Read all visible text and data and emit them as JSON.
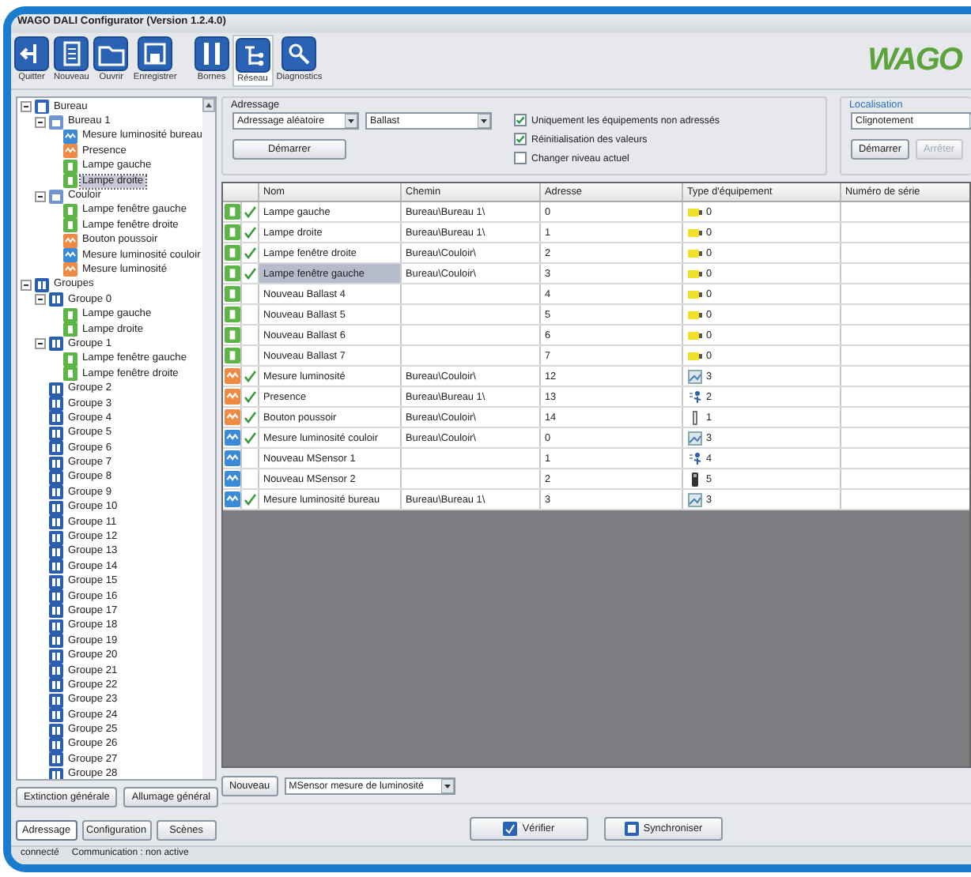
{
  "window": {
    "title": "WAGO DALI Configurator (Version 1.2.4.0)"
  },
  "toolbar": [
    {
      "label": "Quitter",
      "kind": "exit",
      "selected": false
    },
    {
      "label": "Nouveau",
      "kind": "new",
      "selected": false
    },
    {
      "label": "Ouvrir",
      "kind": "open",
      "selected": false
    },
    {
      "label": "Enregistrer",
      "kind": "save",
      "selected": false
    },
    {
      "label": "Bornes",
      "kind": "terminals",
      "selected": false
    },
    {
      "label": "Réseau",
      "kind": "network",
      "selected": true
    },
    {
      "label": "Diagnostics",
      "kind": "diagnostics",
      "selected": false
    }
  ],
  "logo": "WAGO",
  "tree": [
    {
      "label": "Bureau",
      "kind": "building",
      "selected": false,
      "expanded": true,
      "children": [
        {
          "label": "Bureau 1",
          "kind": "room",
          "selected": false,
          "expanded": true,
          "children": [
            {
              "label": "Mesure luminosité bureau",
              "kind": "sensor",
              "selected": false
            },
            {
              "label": "Presence",
              "kind": "input",
              "selected": false
            },
            {
              "label": "Lampe gauche",
              "kind": "lamp",
              "selected": false
            },
            {
              "label": "Lampe droite",
              "kind": "lamp",
              "selected": true
            }
          ]
        },
        {
          "label": "Couloir",
          "kind": "room",
          "selected": false,
          "expanded": true,
          "children": [
            {
              "label": "Lampe fenêtre gauche",
              "kind": "lamp",
              "selected": false
            },
            {
              "label": "Lampe fenêtre droite",
              "kind": "lamp",
              "selected": false
            },
            {
              "label": "Bouton poussoir",
              "kind": "input",
              "selected": false
            },
            {
              "label": "Mesure luminosité couloir",
              "kind": "sensor",
              "selected": false
            },
            {
              "label": "Mesure luminosité",
              "kind": "input",
              "selected": false
            }
          ]
        }
      ]
    },
    {
      "label": "Groupes",
      "kind": "group",
      "selected": false,
      "expanded": true,
      "children": [
        {
          "label": "Groupe 0",
          "kind": "group",
          "selected": false,
          "expanded": true,
          "children": [
            {
              "label": "Lampe gauche",
              "kind": "lamp",
              "selected": false
            },
            {
              "label": "Lampe droite",
              "kind": "lamp",
              "selected": false
            }
          ]
        },
        {
          "label": "Groupe 1",
          "kind": "group",
          "selected": false,
          "expanded": true,
          "children": [
            {
              "label": "Lampe fenêtre gauche",
              "kind": "lamp",
              "selected": false
            },
            {
              "label": "Lampe fenêtre droite",
              "kind": "lamp",
              "selected": false
            }
          ]
        },
        {
          "label": "Groupe 2",
          "kind": "group",
          "selected": false
        },
        {
          "label": "Groupe 3",
          "kind": "group",
          "selected": false
        },
        {
          "label": "Groupe 4",
          "kind": "group",
          "selected": false
        },
        {
          "label": "Groupe 5",
          "kind": "group",
          "selected": false
        },
        {
          "label": "Groupe 6",
          "kind": "group",
          "selected": false
        },
        {
          "label": "Groupe 7",
          "kind": "group",
          "selected": false
        },
        {
          "label": "Groupe 8",
          "kind": "group",
          "selected": false
        },
        {
          "label": "Groupe 9",
          "kind": "group",
          "selected": false
        },
        {
          "label": "Groupe 10",
          "kind": "group",
          "selected": false
        },
        {
          "label": "Groupe 11",
          "kind": "group",
          "selected": false
        },
        {
          "label": "Groupe 12",
          "kind": "group",
          "selected": false
        },
        {
          "label": "Groupe 13",
          "kind": "group",
          "selected": false
        },
        {
          "label": "Groupe 14",
          "kind": "group",
          "selected": false
        },
        {
          "label": "Groupe 15",
          "kind": "group",
          "selected": false
        },
        {
          "label": "Groupe 16",
          "kind": "group",
          "selected": false
        },
        {
          "label": "Groupe 17",
          "kind": "group",
          "selected": false
        },
        {
          "label": "Groupe 18",
          "kind": "group",
          "selected": false
        },
        {
          "label": "Groupe 19",
          "kind": "group",
          "selected": false
        },
        {
          "label": "Groupe 20",
          "kind": "group",
          "selected": false
        },
        {
          "label": "Groupe 21",
          "kind": "group",
          "selected": false
        },
        {
          "label": "Groupe 22",
          "kind": "group",
          "selected": false
        },
        {
          "label": "Groupe 23",
          "kind": "group",
          "selected": false
        },
        {
          "label": "Groupe 24",
          "kind": "group",
          "selected": false
        },
        {
          "label": "Groupe 25",
          "kind": "group",
          "selected": false
        },
        {
          "label": "Groupe 26",
          "kind": "group",
          "selected": false
        },
        {
          "label": "Groupe 27",
          "kind": "group",
          "selected": false
        },
        {
          "label": "Groupe 28",
          "kind": "group",
          "selected": false
        }
      ]
    }
  ],
  "left_buttons": [
    "Extinction générale",
    "Allumage général"
  ],
  "bottom_tabs": [
    {
      "label": "Adressage",
      "selected": true
    },
    {
      "label": "Configuration",
      "selected": false
    },
    {
      "label": "Scènes",
      "selected": false
    }
  ],
  "status_bar": [
    "connecté",
    "Communication : non active"
  ],
  "addressing": {
    "title": "Adressage",
    "mode": "Adressage aléatoire",
    "device": "Ballast",
    "start": "Démarrer",
    "options": [
      {
        "label": "Uniquement les équipements non adressés",
        "checked": true
      },
      {
        "label": "Réinitialisation des valeurs",
        "checked": true
      },
      {
        "label": "Changer niveau actuel",
        "checked": false
      }
    ]
  },
  "localisation": {
    "title": "Localisation",
    "mode": "Clignotement",
    "start": {
      "label": "Démarrer",
      "disabled": false
    },
    "stop": {
      "label": "Arrêter",
      "disabled": true
    }
  },
  "table": {
    "columns": [
      "Nom",
      "Chemin",
      "Adresse",
      "Type d'équipement",
      "Numéro de série"
    ],
    "rows": [
      {
        "kind": "lamp",
        "addressed": true,
        "name": "Lampe gauche",
        "path": "Bureau\\Bureau 1\\",
        "address": "0",
        "type": {
          "kind": "ballast",
          "value": "0"
        },
        "selected": false
      },
      {
        "kind": "lamp",
        "addressed": true,
        "name": "Lampe droite",
        "path": "Bureau\\Bureau 1\\",
        "address": "1",
        "type": {
          "kind": "ballast",
          "value": "0"
        },
        "selected": false
      },
      {
        "kind": "lamp",
        "addressed": true,
        "name": "Lampe fenêtre droite",
        "path": "Bureau\\Couloir\\",
        "address": "2",
        "type": {
          "kind": "ballast",
          "value": "0"
        },
        "selected": false
      },
      {
        "kind": "lamp",
        "addressed": true,
        "name": "Lampe fenêtre gauche",
        "path": "Bureau\\Couloir\\",
        "address": "3",
        "type": {
          "kind": "ballast",
          "value": "0"
        },
        "selected": true
      },
      {
        "kind": "lamp",
        "addressed": false,
        "name": "Nouveau Ballast 4",
        "address": "4",
        "type": {
          "kind": "ballast",
          "value": "0"
        },
        "selected": false
      },
      {
        "kind": "lamp",
        "addressed": false,
        "name": "Nouveau Ballast 5",
        "address": "5",
        "type": {
          "kind": "ballast",
          "value": "0"
        },
        "selected": false
      },
      {
        "kind": "lamp",
        "addressed": false,
        "name": "Nouveau Ballast 6",
        "address": "6",
        "type": {
          "kind": "ballast",
          "value": "0"
        },
        "selected": false
      },
      {
        "kind": "lamp",
        "addressed": false,
        "name": "Nouveau Ballast 7",
        "address": "7",
        "type": {
          "kind": "ballast",
          "value": "0"
        },
        "selected": false
      },
      {
        "kind": "input",
        "addressed": true,
        "name": "Mesure luminosité",
        "path": "Bureau\\Couloir\\",
        "address": "12",
        "type": {
          "kind": "light",
          "value": "3"
        },
        "selected": false
      },
      {
        "kind": "input",
        "addressed": true,
        "name": "Presence",
        "path": "Bureau\\Bureau 1\\",
        "address": "13",
        "type": {
          "kind": "presence",
          "value": "2"
        },
        "selected": false
      },
      {
        "kind": "input",
        "addressed": true,
        "name": "Bouton poussoir",
        "path": "Bureau\\Couloir\\",
        "address": "14",
        "type": {
          "kind": "switch",
          "value": "1"
        },
        "selected": false
      },
      {
        "kind": "sensor",
        "addressed": true,
        "name": "Mesure luminosité couloir",
        "path": "Bureau\\Couloir\\",
        "address": "0",
        "type": {
          "kind": "light",
          "value": "3"
        },
        "selected": false
      },
      {
        "kind": "sensor",
        "addressed": false,
        "name": "Nouveau MSensor 1",
        "address": "1",
        "type": {
          "kind": "presence",
          "value": "4"
        },
        "selected": false
      },
      {
        "kind": "sensor",
        "addressed": false,
        "name": "Nouveau MSensor 2",
        "address": "2",
        "type": {
          "kind": "handheld",
          "value": "5"
        },
        "selected": false
      },
      {
        "kind": "sensor",
        "addressed": true,
        "name": "Mesure luminosité bureau",
        "path": "Bureau\\Bureau 1\\",
        "address": "3",
        "type": {
          "kind": "light",
          "value": "3"
        },
        "selected": false
      }
    ]
  },
  "new_device": {
    "button": "Nouveau",
    "type": "MSensor mesure de luminosité"
  },
  "actions": [
    {
      "label": "Vérifier",
      "kind": "check"
    },
    {
      "label": "Synchroniser",
      "kind": "sync"
    }
  ]
}
